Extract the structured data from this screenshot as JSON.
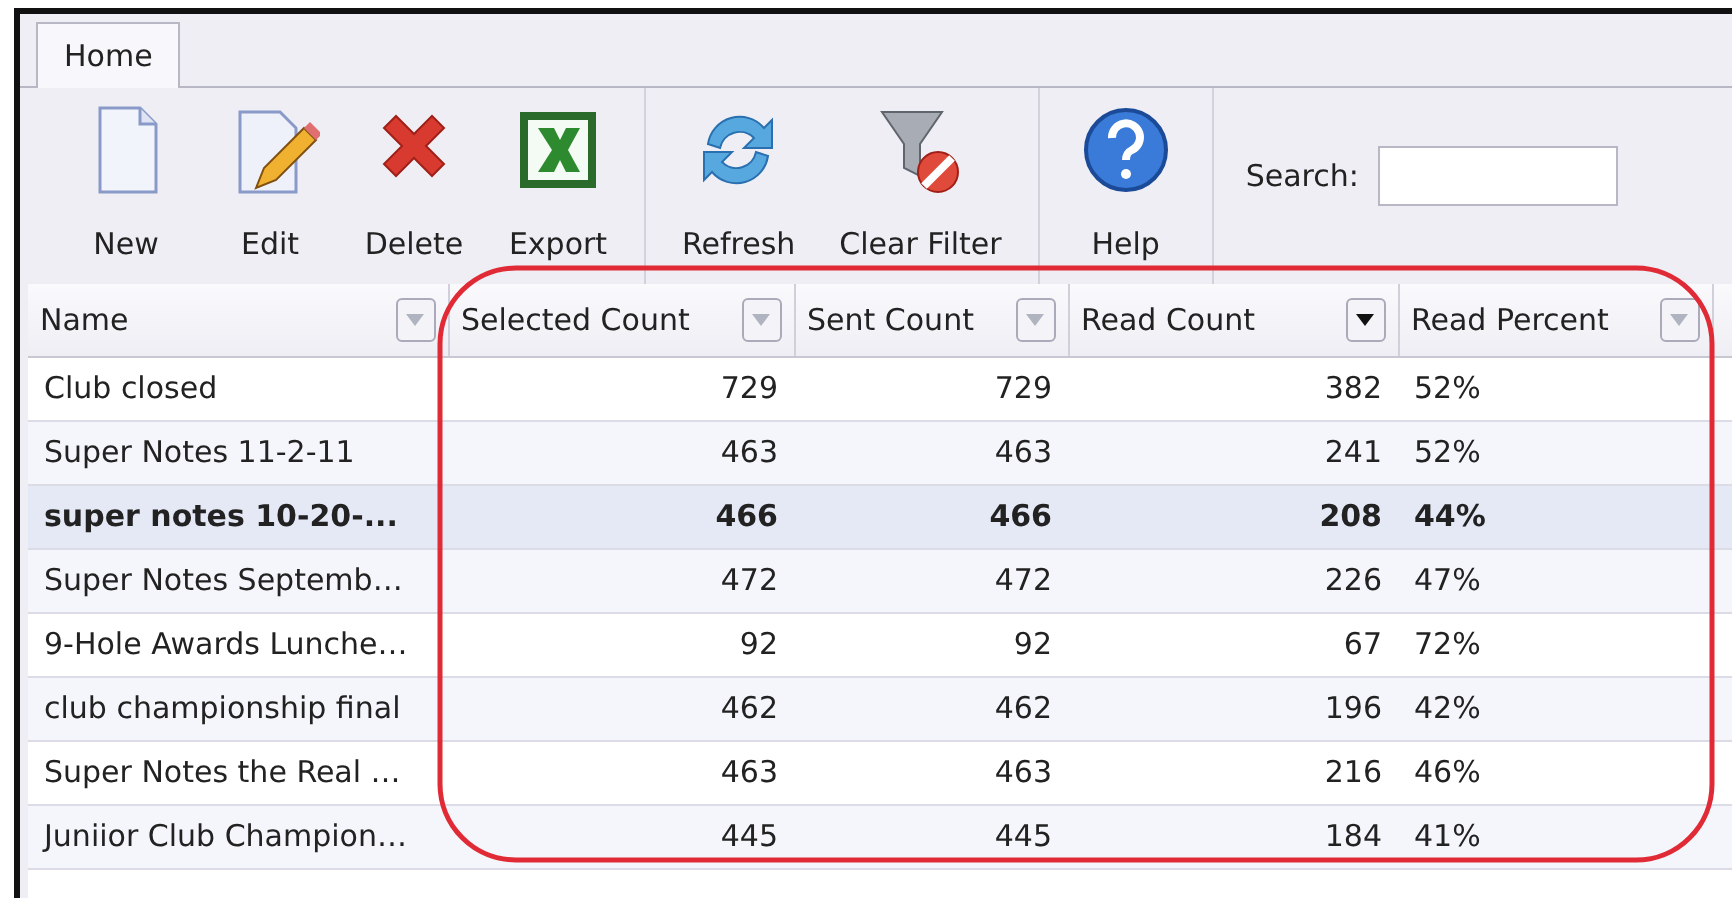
{
  "tabs": [
    {
      "label": "Home",
      "selected": true
    }
  ],
  "toolbar": {
    "groups": [
      [
        {
          "label": "New"
        },
        {
          "label": "Edit"
        },
        {
          "label": "Delete"
        },
        {
          "label": "Export"
        }
      ],
      [
        {
          "label": "Refresh"
        },
        {
          "label": "Clear Filter"
        }
      ],
      [
        {
          "label": "Help"
        }
      ]
    ],
    "search": {
      "label": "Search:"
    }
  },
  "table": {
    "columns": [
      {
        "label": "Name",
        "filter_active": false
      },
      {
        "label": "Selected Count",
        "filter_active": false
      },
      {
        "label": "Sent Count",
        "filter_active": false
      },
      {
        "label": "Read Count",
        "filter_active": true
      },
      {
        "label": "Read Percent",
        "filter_active": false
      }
    ],
    "rows": [
      {
        "selected": false,
        "cells": [
          "Club closed",
          "729",
          "729",
          "382",
          "52%"
        ]
      },
      {
        "selected": false,
        "cells": [
          "Super Notes 11-2-11",
          "463",
          "463",
          "241",
          "52%"
        ]
      },
      {
        "selected": true,
        "cells": [
          "super notes 10-20-...",
          "466",
          "466",
          "208",
          "44%"
        ]
      },
      {
        "selected": false,
        "cells": [
          "Super Notes Septemb…",
          "472",
          "472",
          "226",
          "47%"
        ]
      },
      {
        "selected": false,
        "cells": [
          "9-Hole Awards Lunche…",
          "92",
          "92",
          "67",
          "72%"
        ]
      },
      {
        "selected": false,
        "cells": [
          "club championship final",
          "462",
          "462",
          "196",
          "42%"
        ]
      },
      {
        "selected": false,
        "cells": [
          "Super Notes the Real …",
          "463",
          "463",
          "216",
          "46%"
        ]
      },
      {
        "selected": false,
        "cells": [
          "Juniior Club Champion…",
          "445",
          "445",
          "184",
          "41%"
        ]
      }
    ]
  }
}
